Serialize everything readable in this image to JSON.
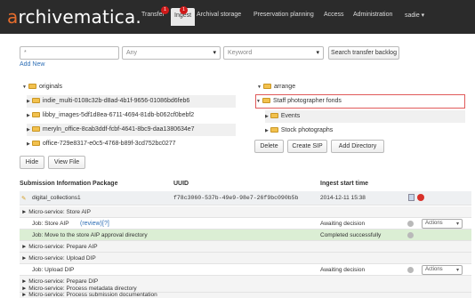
{
  "app": {
    "logo_first": "a",
    "logo_rest": "rchivematica."
  },
  "nav": {
    "items": [
      "Transfer",
      "Ingest",
      "Archival storage",
      "Preservation planning",
      "Access",
      "Administration",
      "sadie ▾"
    ],
    "badge_transfer": "1",
    "badge_ingest": "1"
  },
  "search": {
    "query_value": "*",
    "scope_value": "Any",
    "keyword_value": "Keyword",
    "search_button": "Search transfer backlog",
    "add_new": "Add New"
  },
  "originals": {
    "root_label": "originals",
    "items": [
      "indie_multi-0108c32b-d8ad-4b1f-9656-01086bd6feb6",
      "libby_images-5df1d8ea-6711-4694-81db-b062cf0bebf2",
      "meryln_office-8cab3ddf-fcbf-4641-8bc9-daa1380634e7",
      "office-729e8317-e0c5-4768-b89f-3cd752bc0277"
    ],
    "hide_button": "Hide",
    "view_file_button": "View File"
  },
  "arrange": {
    "root_label": "arrange",
    "selected_item": "Staff photographer fonds",
    "children": [
      "Events",
      "Stock photographs"
    ],
    "delete_button": "Delete",
    "create_sip_button": "Create SIP",
    "add_directory_button": "Add Directory"
  },
  "table": {
    "headers": [
      "Submission Information Package",
      "UUID",
      "Ingest start time"
    ],
    "sip": {
      "name": "digital_collections1",
      "uuid": "f78c3060-537b-49e9-98e7-26f9bc090b5b",
      "time": "2014-12-11 15:38"
    },
    "rows": [
      {
        "type": "ms",
        "text": "► Micro-service: Store AIP"
      },
      {
        "type": "job",
        "text": "Job: Store AIP",
        "review": "(review)",
        "help": "[?]",
        "status": "Awaiting decision",
        "actions": "Actions"
      },
      {
        "type": "job-green",
        "text": "Job: Move to the store AIP approval directory",
        "status": "Completed successfully"
      },
      {
        "type": "ms",
        "text": "► Micro-service: Prepare AIP"
      },
      {
        "type": "ms",
        "text": "► Micro-service: Upload DIP"
      },
      {
        "type": "job",
        "text": "Job: Upload DIP",
        "status": "Awaiting decision",
        "actions": "Actions"
      },
      {
        "type": "ms",
        "text": "► Micro-service: Prepare DIP"
      },
      {
        "type": "ms",
        "text": "► Micro-service: Process metadata directory"
      },
      {
        "type": "ms",
        "text": "► Micro-service: Process submission documentation"
      }
    ]
  }
}
